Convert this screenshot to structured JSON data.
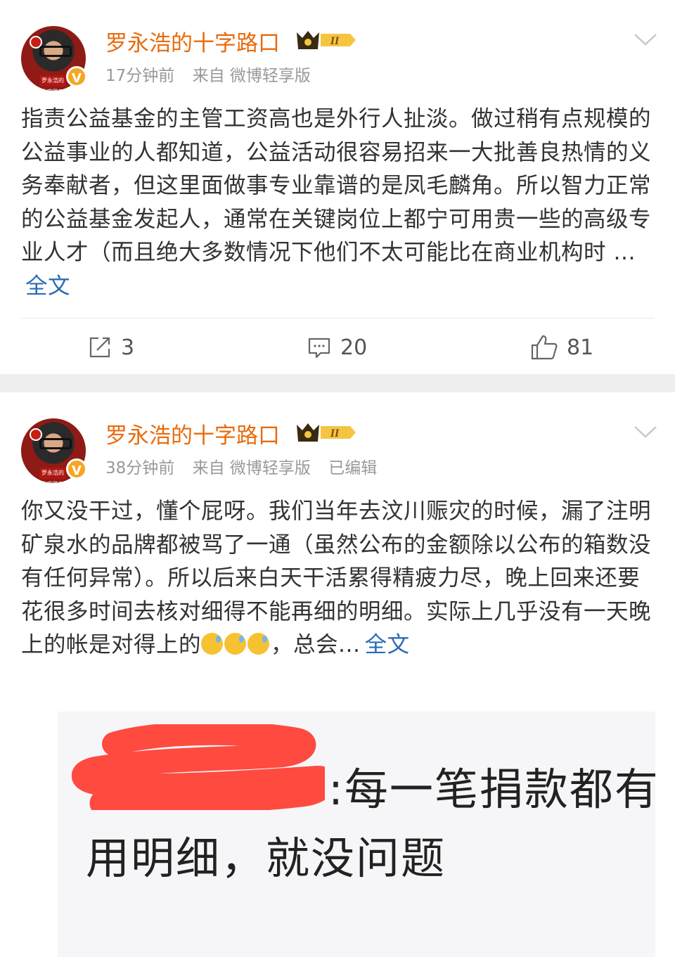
{
  "posts": [
    {
      "username": "罗永浩的十字路口",
      "vip_level": "II",
      "avatar_caption": "罗永浩的十字路口",
      "time": "17分钟前",
      "source": "来自 微博轻享版",
      "edited": "",
      "text": "指责公益基金的主管工资高也是外行人扯淡。做过稍有点规模的公益事业的人都知道，公益活动很容易招来一大批善良热情的义务奉献者，￼但这里面做事专业靠谱的是凤毛麟角。所以智力正常的公益基金发起人￼，通常在关键岗位上都宁可用贵一些的高级专业人才（而且绝大多数情况下他们不太可能比在商业机构时 ...",
      "more": "全文",
      "reposts": "3",
      "comments": "20",
      "likes": "81"
    },
    {
      "username": "罗永浩的十字路口",
      "vip_level": "II",
      "avatar_caption": "罗永浩的十字路口",
      "time": "38分钟前",
      "source": "来自 微博轻享版",
      "edited": "已编辑",
      "text": "你又没干过，懂个屁呀。我们当年去汶川赈灾的时候，漏了注明矿泉水的品牌都被骂了一通（虽然公布的金额除以公布的箱数没有任何异常）。所以后来白天干活累得精疲力尽，晚上回来还要花很多时间去核对细得不能再细的明细。实际上几乎没有一天晚上的帐是对得上的",
      "text_tail": "，总会...",
      "emoji": [
        "sweat-smile-emoji",
        "sweat-smile-emoji",
        "sweat-smile-emoji"
      ],
      "more": "全文",
      "image": {
        "line1": ":每一笔捐款都有",
        "line2": "用明细，就没问题"
      }
    }
  ],
  "colors": {
    "username": "#e86b0c",
    "link": "#2a6cb3",
    "meta": "#999999",
    "divider": "#eeeeee",
    "redaction": "#ff3b30"
  }
}
